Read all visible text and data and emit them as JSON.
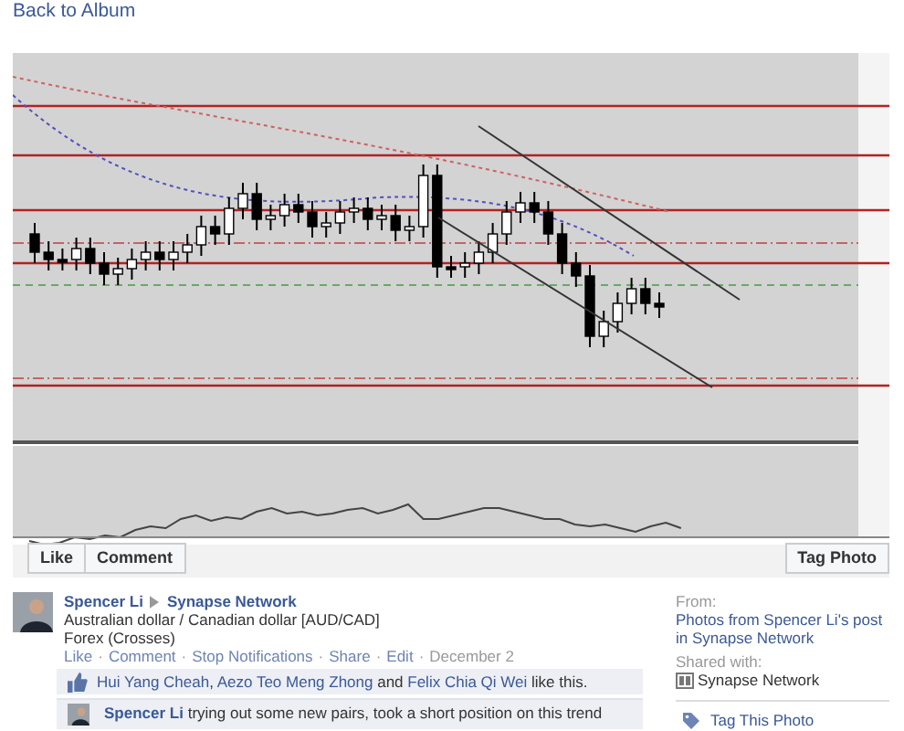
{
  "back_link": "Back to Album",
  "photo_buttons": [
    "Like",
    "Comment"
  ],
  "tag_button": "Tag Photo",
  "post": {
    "author": "Spencer Li",
    "group": "Synapse Network",
    "lines": [
      "Australian dollar / Canadian dollar [AUD/CAD]",
      "Forex (Crosses)"
    ],
    "separator": "·",
    "actions": [
      {
        "label": "Like",
        "kind": "link"
      },
      {
        "label": "Comment",
        "kind": "link"
      },
      {
        "label": "Stop Notifications",
        "kind": "link"
      },
      {
        "label": "Share",
        "kind": "link"
      },
      {
        "label": "Edit",
        "kind": "link"
      },
      {
        "label": "December 2",
        "kind": "date"
      }
    ],
    "likes": {
      "names": [
        "Hui Yang Cheah",
        "Aezo Teo Meng Zhong",
        "Felix Chia Qi Wei"
      ],
      "comma": ",",
      "and": "and",
      "suffix": "like this."
    },
    "comment": {
      "author": "Spencer Li",
      "text": "trying out some new pairs, took a short position on this trend"
    }
  },
  "sidebar": {
    "from_label": "From:",
    "from_link": "Photos from Spencer Li's post in Synapse Network",
    "shared_label": "Shared with:",
    "shared_with": "Synapse Network",
    "tag_action": "Tag This Photo"
  }
}
